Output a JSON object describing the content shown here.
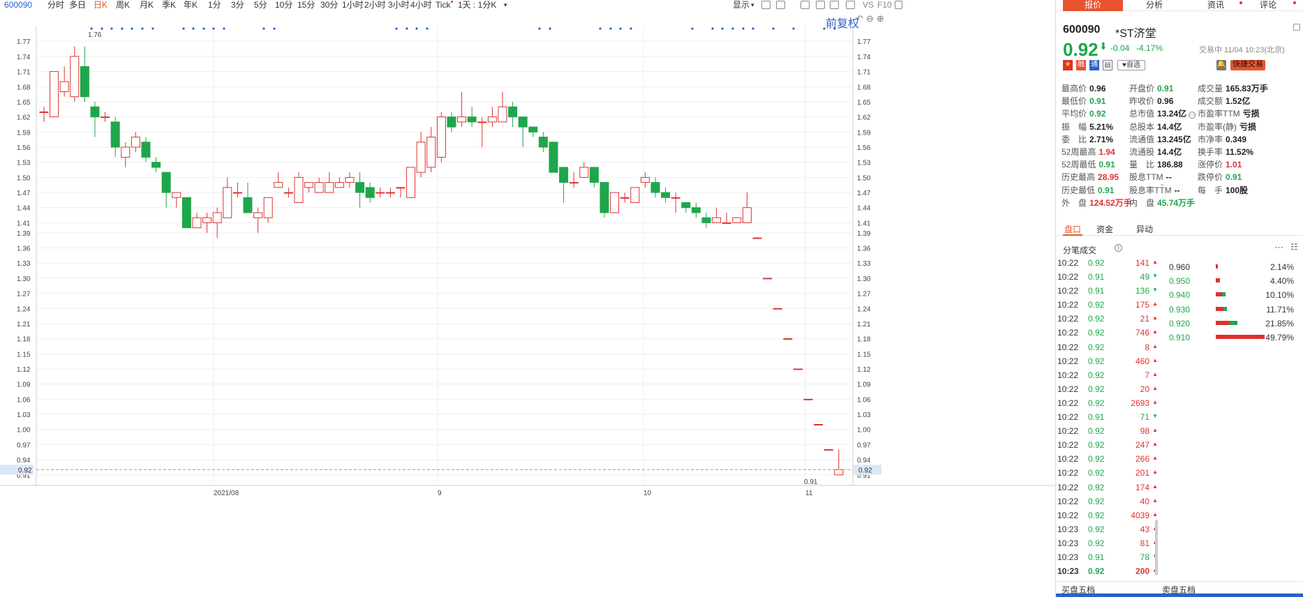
{
  "toolbar": {
    "code": "600090",
    "periods": [
      "分时",
      "多日",
      "日K",
      "周K",
      "月K",
      "季K",
      "年K",
      "1分",
      "3分",
      "5分",
      "10分",
      "15分",
      "30分",
      "1小时",
      "2小时",
      "3小时",
      "4小时",
      "Tick"
    ],
    "active_period": "日K",
    "interval_select": "1天 : 1分K",
    "display_label": "显示",
    "vs_label": "VS",
    "f10_label": "F10",
    "fq_label": "前复权"
  },
  "colors": {
    "up": "#e03030",
    "down": "#1fa64c",
    "accent": "#e8542f",
    "link": "#2a62c9"
  },
  "chart_data": {
    "type": "candlestick",
    "y_ticks": [
      "1.77",
      "1.74",
      "1.71",
      "1.68",
      "1.65",
      "1.62",
      "1.59",
      "1.56",
      "1.53",
      "1.50",
      "1.47",
      "1.44",
      "1.41",
      "1.39",
      "1.36",
      "1.33",
      "1.30",
      "1.27",
      "1.24",
      "1.21",
      "1.18",
      "1.15",
      "1.12",
      "1.09",
      "1.06",
      "1.03",
      "1.00",
      "0.97",
      "0.94",
      "0.91"
    ],
    "ylim": [
      0.9,
      1.78
    ],
    "x_labels": [
      "2021/08",
      "9",
      "10",
      "11"
    ],
    "current_price_label": "0.92",
    "max_label": "1.76",
    "min_label": "0.91",
    "candles": [
      {
        "o": 1.63,
        "h": 1.64,
        "l": 1.61,
        "c": 1.63
      },
      {
        "o": 1.62,
        "h": 1.71,
        "l": 1.62,
        "c": 1.71
      },
      {
        "o": 1.67,
        "h": 1.72,
        "l": 1.66,
        "c": 1.69
      },
      {
        "o": 1.66,
        "h": 1.76,
        "l": 1.65,
        "c": 1.74
      },
      {
        "o": 1.72,
        "h": 1.76,
        "l": 1.65,
        "c": 1.66
      },
      {
        "o": 1.64,
        "h": 1.65,
        "l": 1.58,
        "c": 1.62
      },
      {
        "o": 1.62,
        "h": 1.63,
        "l": 1.61,
        "c": 1.62
      },
      {
        "o": 1.61,
        "h": 1.62,
        "l": 1.54,
        "c": 1.56
      },
      {
        "o": 1.54,
        "h": 1.57,
        "l": 1.52,
        "c": 1.56
      },
      {
        "o": 1.56,
        "h": 1.59,
        "l": 1.55,
        "c": 1.58
      },
      {
        "o": 1.57,
        "h": 1.58,
        "l": 1.53,
        "c": 1.54
      },
      {
        "o": 1.53,
        "h": 1.54,
        "l": 1.51,
        "c": 1.52
      },
      {
        "o": 1.51,
        "h": 1.51,
        "l": 1.44,
        "c": 1.47
      },
      {
        "o": 1.46,
        "h": 1.47,
        "l": 1.44,
        "c": 1.47
      },
      {
        "o": 1.46,
        "h": 1.46,
        "l": 1.4,
        "c": 1.4
      },
      {
        "o": 1.4,
        "h": 1.43,
        "l": 1.4,
        "c": 1.42
      },
      {
        "o": 1.41,
        "h": 1.43,
        "l": 1.39,
        "c": 1.42
      },
      {
        "o": 1.41,
        "h": 1.44,
        "l": 1.38,
        "c": 1.43
      },
      {
        "o": 1.42,
        "h": 1.5,
        "l": 1.42,
        "c": 1.48
      },
      {
        "o": 1.47,
        "h": 1.49,
        "l": 1.46,
        "c": 1.47
      },
      {
        "o": 1.46,
        "h": 1.49,
        "l": 1.43,
        "c": 1.43
      },
      {
        "o": 1.42,
        "h": 1.44,
        "l": 1.39,
        "c": 1.43
      },
      {
        "o": 1.42,
        "h": 1.46,
        "l": 1.41,
        "c": 1.46
      },
      {
        "o": 1.48,
        "h": 1.51,
        "l": 1.48,
        "c": 1.49
      },
      {
        "o": 1.47,
        "h": 1.48,
        "l": 1.46,
        "c": 1.47
      },
      {
        "o": 1.45,
        "h": 1.51,
        "l": 1.45,
        "c": 1.5
      },
      {
        "o": 1.48,
        "h": 1.49,
        "l": 1.47,
        "c": 1.49
      },
      {
        "o": 1.47,
        "h": 1.5,
        "l": 1.47,
        "c": 1.49
      },
      {
        "o": 1.47,
        "h": 1.51,
        "l": 1.47,
        "c": 1.49
      },
      {
        "o": 1.48,
        "h": 1.5,
        "l": 1.48,
        "c": 1.49
      },
      {
        "o": 1.49,
        "h": 1.51,
        "l": 1.48,
        "c": 1.5
      },
      {
        "o": 1.49,
        "h": 1.51,
        "l": 1.44,
        "c": 1.47
      },
      {
        "o": 1.48,
        "h": 1.49,
        "l": 1.45,
        "c": 1.46
      },
      {
        "o": 1.47,
        "h": 1.48,
        "l": 1.46,
        "c": 1.47
      },
      {
        "o": 1.47,
        "h": 1.48,
        "l": 1.46,
        "c": 1.47
      },
      {
        "o": 1.48,
        "h": 1.48,
        "l": 1.46,
        "c": 1.48
      },
      {
        "o": 1.46,
        "h": 1.52,
        "l": 1.46,
        "c": 1.52
      },
      {
        "o": 1.51,
        "h": 1.59,
        "l": 1.5,
        "c": 1.57
      },
      {
        "o": 1.52,
        "h": 1.6,
        "l": 1.51,
        "c": 1.58
      },
      {
        "o": 1.54,
        "h": 1.63,
        "l": 1.53,
        "c": 1.62
      },
      {
        "o": 1.62,
        "h": 1.63,
        "l": 1.59,
        "c": 1.6
      },
      {
        "o": 1.61,
        "h": 1.67,
        "l": 1.6,
        "c": 1.62
      },
      {
        "o": 1.62,
        "h": 1.64,
        "l": 1.6,
        "c": 1.61
      },
      {
        "o": 1.61,
        "h": 1.62,
        "l": 1.56,
        "c": 1.61
      },
      {
        "o": 1.61,
        "h": 1.64,
        "l": 1.6,
        "c": 1.62
      },
      {
        "o": 1.61,
        "h": 1.67,
        "l": 1.61,
        "c": 1.64
      },
      {
        "o": 1.64,
        "h": 1.65,
        "l": 1.6,
        "c": 1.62
      },
      {
        "o": 1.62,
        "h": 1.62,
        "l": 1.56,
        "c": 1.6
      },
      {
        "o": 1.6,
        "h": 1.6,
        "l": 1.58,
        "c": 1.59
      },
      {
        "o": 1.58,
        "h": 1.59,
        "l": 1.55,
        "c": 1.56
      },
      {
        "o": 1.57,
        "h": 1.57,
        "l": 1.51,
        "c": 1.51
      },
      {
        "o": 1.52,
        "h": 1.52,
        "l": 1.45,
        "c": 1.49
      },
      {
        "o": 1.49,
        "h": 1.51,
        "l": 1.48,
        "c": 1.49
      },
      {
        "o": 1.5,
        "h": 1.53,
        "l": 1.5,
        "c": 1.52
      },
      {
        "o": 1.52,
        "h": 1.52,
        "l": 1.48,
        "c": 1.49
      },
      {
        "o": 1.49,
        "h": 1.49,
        "l": 1.42,
        "c": 1.43
      },
      {
        "o": 1.43,
        "h": 1.47,
        "l": 1.43,
        "c": 1.47
      },
      {
        "o": 1.46,
        "h": 1.47,
        "l": 1.45,
        "c": 1.46
      },
      {
        "o": 1.45,
        "h": 1.48,
        "l": 1.45,
        "c": 1.48
      },
      {
        "o": 1.49,
        "h": 1.51,
        "l": 1.48,
        "c": 1.5
      },
      {
        "o": 1.49,
        "h": 1.5,
        "l": 1.46,
        "c": 1.47
      },
      {
        "o": 1.47,
        "h": 1.48,
        "l": 1.45,
        "c": 1.46
      },
      {
        "o": 1.46,
        "h": 1.47,
        "l": 1.43,
        "c": 1.46
      },
      {
        "o": 1.45,
        "h": 1.45,
        "l": 1.43,
        "c": 1.44
      },
      {
        "o": 1.44,
        "h": 1.45,
        "l": 1.42,
        "c": 1.43
      },
      {
        "o": 1.42,
        "h": 1.43,
        "l": 1.4,
        "c": 1.41
      },
      {
        "o": 1.41,
        "h": 1.44,
        "l": 1.41,
        "c": 1.42
      },
      {
        "o": 1.41,
        "h": 1.43,
        "l": 1.41,
        "c": 1.41
      },
      {
        "o": 1.41,
        "h": 1.42,
        "l": 1.41,
        "c": 1.42
      },
      {
        "o": 1.41,
        "h": 1.47,
        "l": 1.41,
        "c": 1.44
      },
      {
        "o": 1.38,
        "h": 1.38,
        "l": 1.38,
        "c": 1.38
      },
      {
        "o": 1.3,
        "h": 1.3,
        "l": 1.3,
        "c": 1.3
      },
      {
        "o": 1.24,
        "h": 1.24,
        "l": 1.24,
        "c": 1.24
      },
      {
        "o": 1.18,
        "h": 1.18,
        "l": 1.18,
        "c": 1.18
      },
      {
        "o": 1.12,
        "h": 1.12,
        "l": 1.12,
        "c": 1.12
      },
      {
        "o": 1.06,
        "h": 1.06,
        "l": 1.06,
        "c": 1.06
      },
      {
        "o": 1.01,
        "h": 1.01,
        "l": 1.01,
        "c": 1.01
      },
      {
        "o": 0.96,
        "h": 0.96,
        "l": 0.96,
        "c": 0.96
      },
      {
        "o": 0.91,
        "h": 0.96,
        "l": 0.91,
        "c": 0.92
      }
    ]
  },
  "panel": {
    "tabs": [
      "报价",
      "分析",
      "资讯",
      "评论"
    ],
    "code": "600090",
    "name": "*ST济堂",
    "price": "0.92",
    "change": "-0.04",
    "change_pct": "-4.17%",
    "meta": "交易中 11/04 10:23(北京)",
    "watch_label": "自选",
    "trade_button": "快捷交易",
    "stats": [
      [
        {
          "l": "最高价",
          "v": "0.96",
          "c": ""
        },
        {
          "l": "开盘价",
          "v": "0.91",
          "c": "green"
        },
        {
          "l": "成交量",
          "v": "165.83万手",
          "c": ""
        }
      ],
      [
        {
          "l": "最低价",
          "v": "0.91",
          "c": "green"
        },
        {
          "l": "昨收价",
          "v": "0.96",
          "c": ""
        },
        {
          "l": "成交额",
          "v": "1.52亿",
          "c": ""
        }
      ],
      [
        {
          "l": "平均价",
          "v": "0.92",
          "c": "green"
        },
        {
          "l": "总市值",
          "v": "13.24亿",
          "c": ""
        },
        {
          "l": "市盈率TTM",
          "v": "亏损",
          "c": ""
        }
      ],
      [
        {
          "l": "振　幅",
          "v": "5.21%",
          "c": ""
        },
        {
          "l": "总股本",
          "v": "14.4亿",
          "c": ""
        },
        {
          "l": "市盈率(静)",
          "v": "亏损",
          "c": ""
        }
      ],
      [
        {
          "l": "委　比",
          "v": "2.71%",
          "c": ""
        },
        {
          "l": "流通值",
          "v": "13.245亿",
          "c": ""
        },
        {
          "l": "市净率",
          "v": "0.349",
          "c": ""
        }
      ],
      [
        {
          "l": "52周最高",
          "v": "1.94",
          "c": "red"
        },
        {
          "l": "流通股",
          "v": "14.4亿",
          "c": ""
        },
        {
          "l": "换手率",
          "v": "11.52%",
          "c": ""
        }
      ],
      [
        {
          "l": "52周最低",
          "v": "0.91",
          "c": "green"
        },
        {
          "l": "量　比",
          "v": "186.88",
          "c": ""
        },
        {
          "l": "涨停价",
          "v": "1.01",
          "c": "red"
        }
      ],
      [
        {
          "l": "历史最高",
          "v": "28.95",
          "c": "red"
        },
        {
          "l": "股息TTM",
          "v": "--",
          "c": ""
        },
        {
          "l": "跌停价",
          "v": "0.91",
          "c": "green"
        }
      ],
      [
        {
          "l": "历史最低",
          "v": "0.91",
          "c": "green"
        },
        {
          "l": "股息率TTM",
          "v": "--",
          "c": ""
        },
        {
          "l": "每　手",
          "v": "100股",
          "c": ""
        }
      ],
      [
        {
          "l": "外　盘",
          "v": "124.52万手",
          "c": "red"
        },
        {
          "l": "内　盘",
          "v": "45.74万手",
          "c": "green"
        },
        {
          "l": "",
          "v": "",
          "c": ""
        }
      ]
    ],
    "sub_tabs": [
      "盘口",
      "资金",
      "异动"
    ],
    "ticks_title": "分笔成交",
    "ticks": [
      {
        "t": "10:22",
        "p": "0.92",
        "v": "141",
        "d": "up"
      },
      {
        "t": "10:22",
        "p": "0.91",
        "v": "49",
        "d": "down"
      },
      {
        "t": "10:22",
        "p": "0.91",
        "v": "136",
        "d": "down"
      },
      {
        "t": "10:22",
        "p": "0.92",
        "v": "175",
        "d": "up"
      },
      {
        "t": "10:22",
        "p": "0.92",
        "v": "21",
        "d": "up"
      },
      {
        "t": "10:22",
        "p": "0.92",
        "v": "746",
        "d": "up"
      },
      {
        "t": "10:22",
        "p": "0.92",
        "v": "8",
        "d": "up"
      },
      {
        "t": "10:22",
        "p": "0.92",
        "v": "460",
        "d": "up"
      },
      {
        "t": "10:22",
        "p": "0.92",
        "v": "7",
        "d": "up"
      },
      {
        "t": "10:22",
        "p": "0.92",
        "v": "20",
        "d": "up"
      },
      {
        "t": "10:22",
        "p": "0.92",
        "v": "2693",
        "d": "up"
      },
      {
        "t": "10:22",
        "p": "0.91",
        "v": "71",
        "d": "down"
      },
      {
        "t": "10:22",
        "p": "0.92",
        "v": "98",
        "d": "up"
      },
      {
        "t": "10:22",
        "p": "0.92",
        "v": "247",
        "d": "up"
      },
      {
        "t": "10:22",
        "p": "0.92",
        "v": "266",
        "d": "up"
      },
      {
        "t": "10:22",
        "p": "0.92",
        "v": "201",
        "d": "up"
      },
      {
        "t": "10:22",
        "p": "0.92",
        "v": "174",
        "d": "up"
      },
      {
        "t": "10:22",
        "p": "0.92",
        "v": "40",
        "d": "up"
      },
      {
        "t": "10:22",
        "p": "0.92",
        "v": "4039",
        "d": "up"
      },
      {
        "t": "10:23",
        "p": "0.92",
        "v": "43",
        "d": "up"
      },
      {
        "t": "10:23",
        "p": "0.92",
        "v": "81",
        "d": "up"
      },
      {
        "t": "10:23",
        "p": "0.91",
        "v": "78",
        "d": "down"
      },
      {
        "t": "10:23",
        "p": "0.92",
        "v": "200",
        "d": "up"
      }
    ],
    "distribution": [
      {
        "p": "0.960",
        "pct": "2.14%",
        "r": 0.02
      },
      {
        "p": "0.950",
        "pct": "4.40%",
        "r": 0.044
      },
      {
        "p": "0.940",
        "pct": "10.10%",
        "r": 0.101
      },
      {
        "p": "0.930",
        "pct": "11.71%",
        "r": 0.117
      },
      {
        "p": "0.920",
        "pct": "21.85%",
        "r": 0.2185
      },
      {
        "p": "0.910",
        "pct": "49.79%",
        "r": 0.4979
      }
    ],
    "buy_label": "买盘五档",
    "sell_label": "卖盘五档"
  }
}
